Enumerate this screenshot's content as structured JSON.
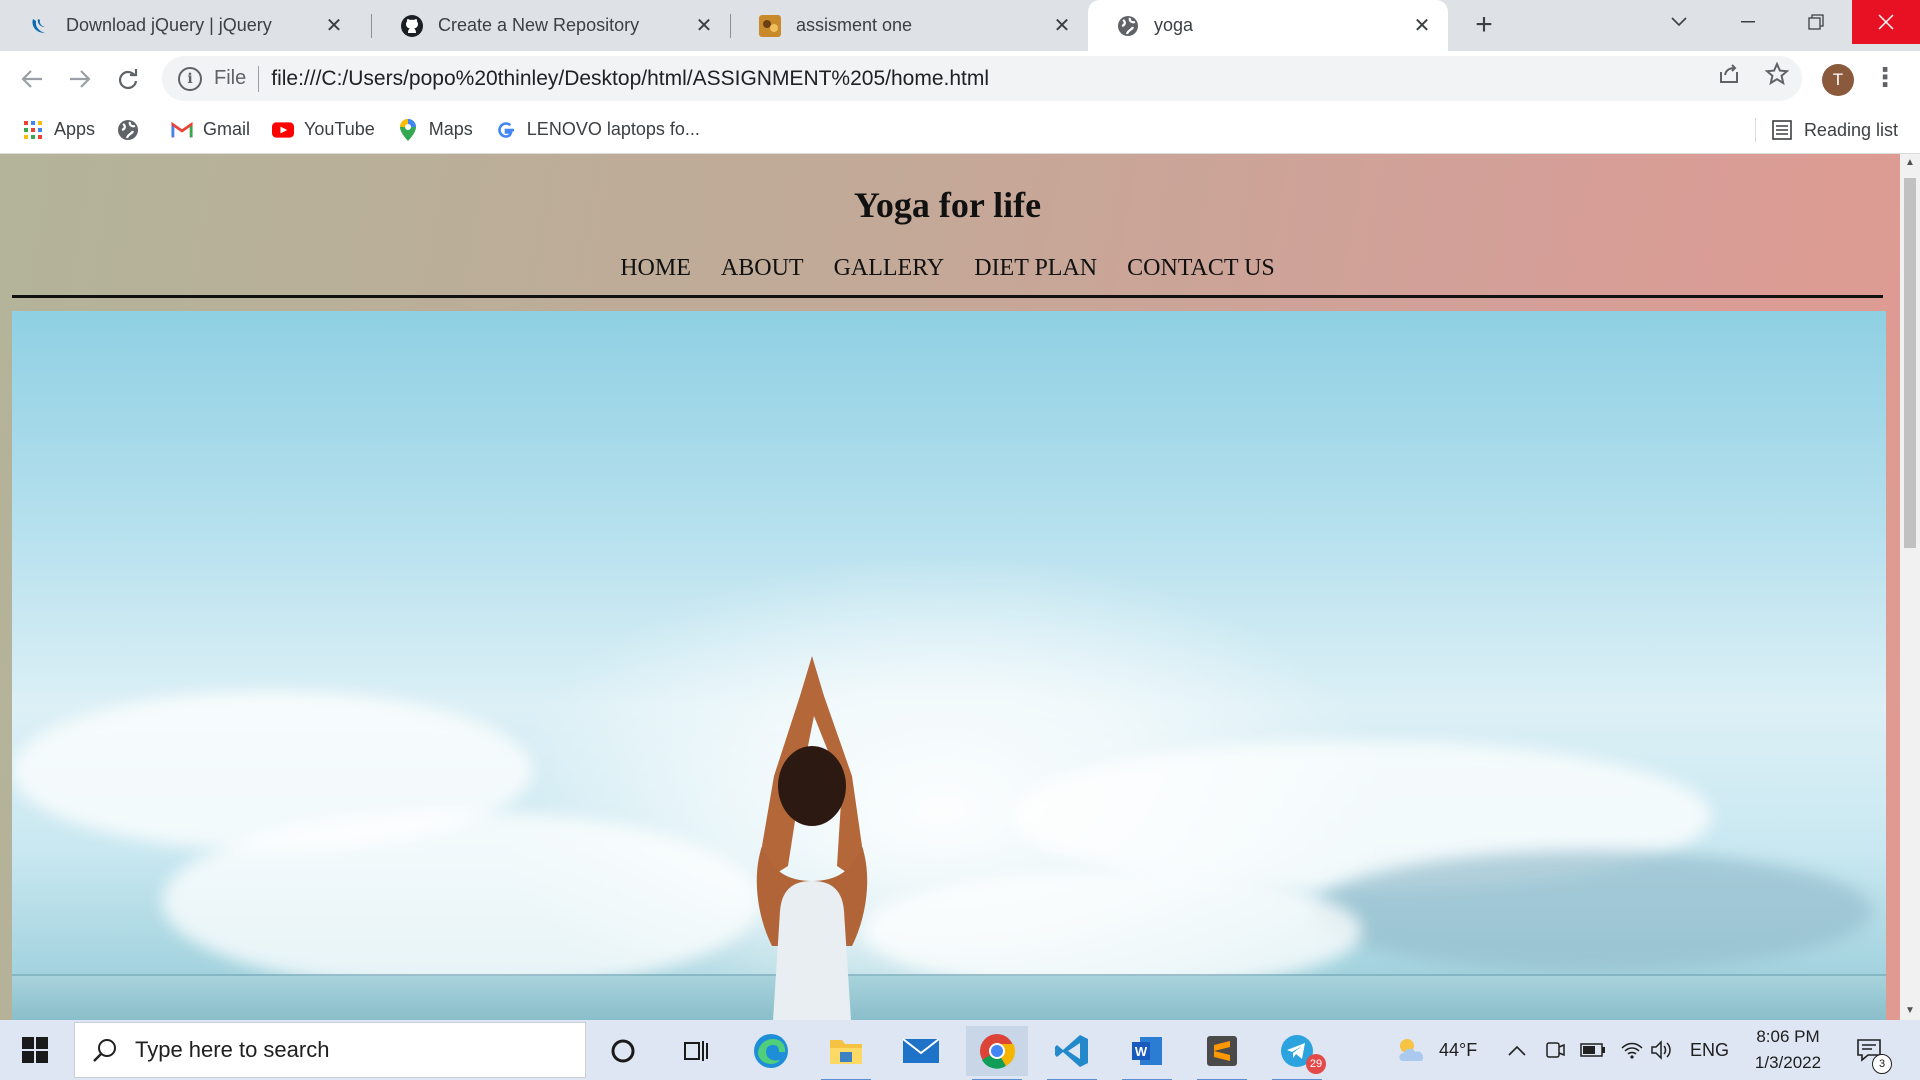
{
  "browser": {
    "tabs": [
      {
        "title": "Download jQuery | jQuery",
        "icon": "jquery-icon",
        "active": false
      },
      {
        "title": "Create a New Repository",
        "icon": "github-icon",
        "active": false
      },
      {
        "title": "assisment one",
        "icon": "image-favicon-icon",
        "active": false
      },
      {
        "title": "yoga",
        "icon": "globe-icon",
        "active": true
      }
    ],
    "new_tab": "+",
    "address": {
      "scheme": "File",
      "url": "file:///C:/Users/popo%20thinley/Desktop/html/ASSIGNMENT%205/home.html"
    },
    "profile_initial": "T",
    "bookmarks": [
      {
        "label": "Apps",
        "icon": "apps-grid-icon"
      },
      {
        "label": "",
        "icon": "globe-icon"
      },
      {
        "label": "Gmail",
        "icon": "gmail-icon"
      },
      {
        "label": "YouTube",
        "icon": "youtube-icon"
      },
      {
        "label": "Maps",
        "icon": "maps-pin-icon"
      },
      {
        "label": "LENOVO laptops fo...",
        "icon": "google-icon"
      }
    ],
    "reading_list": "Reading list"
  },
  "page": {
    "title": "Yoga for life",
    "nav": [
      "HOME",
      "ABOUT",
      "GALLERY",
      "DIET PLAN",
      "CONTACT US"
    ],
    "hero_alt": "yoga-hero-image"
  },
  "taskbar": {
    "search_placeholder": "Type here to search",
    "weather": "44°F",
    "language": "ENG",
    "time": "8:06 PM",
    "date": "1/3/2022",
    "telegram_badge": "29",
    "notifications_badge": "3",
    "colors": {
      "accent": "#5a8fd6",
      "close": "#e81123"
    }
  }
}
